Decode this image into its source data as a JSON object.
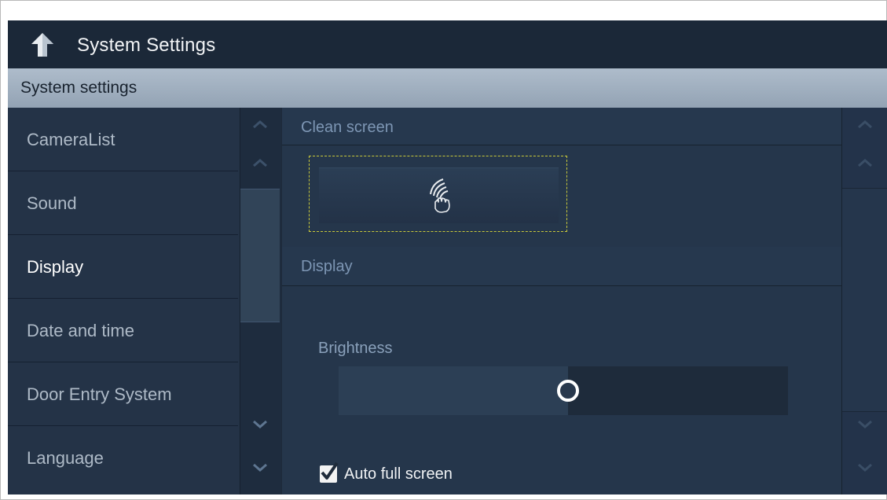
{
  "header": {
    "title": "System Settings",
    "back_icon": "back-arrow-icon"
  },
  "section": {
    "title": "System settings"
  },
  "nav": {
    "items": [
      {
        "label": "CameraList",
        "active": false
      },
      {
        "label": "Sound",
        "active": false
      },
      {
        "label": "Display",
        "active": true
      },
      {
        "label": "Date and time",
        "active": false
      },
      {
        "label": "Door Entry System",
        "active": false
      },
      {
        "label": "Language",
        "active": false
      }
    ]
  },
  "content": {
    "clean_screen": {
      "heading": "Clean screen",
      "button_icon": "hand-wave-icon"
    },
    "display": {
      "heading": "Display",
      "brightness_label": "Brightness",
      "brightness_level": 0.51,
      "auto_full_screen_label": "Auto full screen",
      "auto_full_screen_checked": true
    }
  },
  "colors": {
    "app_bg": "#1d2a3a",
    "accent_header": "#a3b2c2",
    "selection_outline": "#c9c93a"
  }
}
